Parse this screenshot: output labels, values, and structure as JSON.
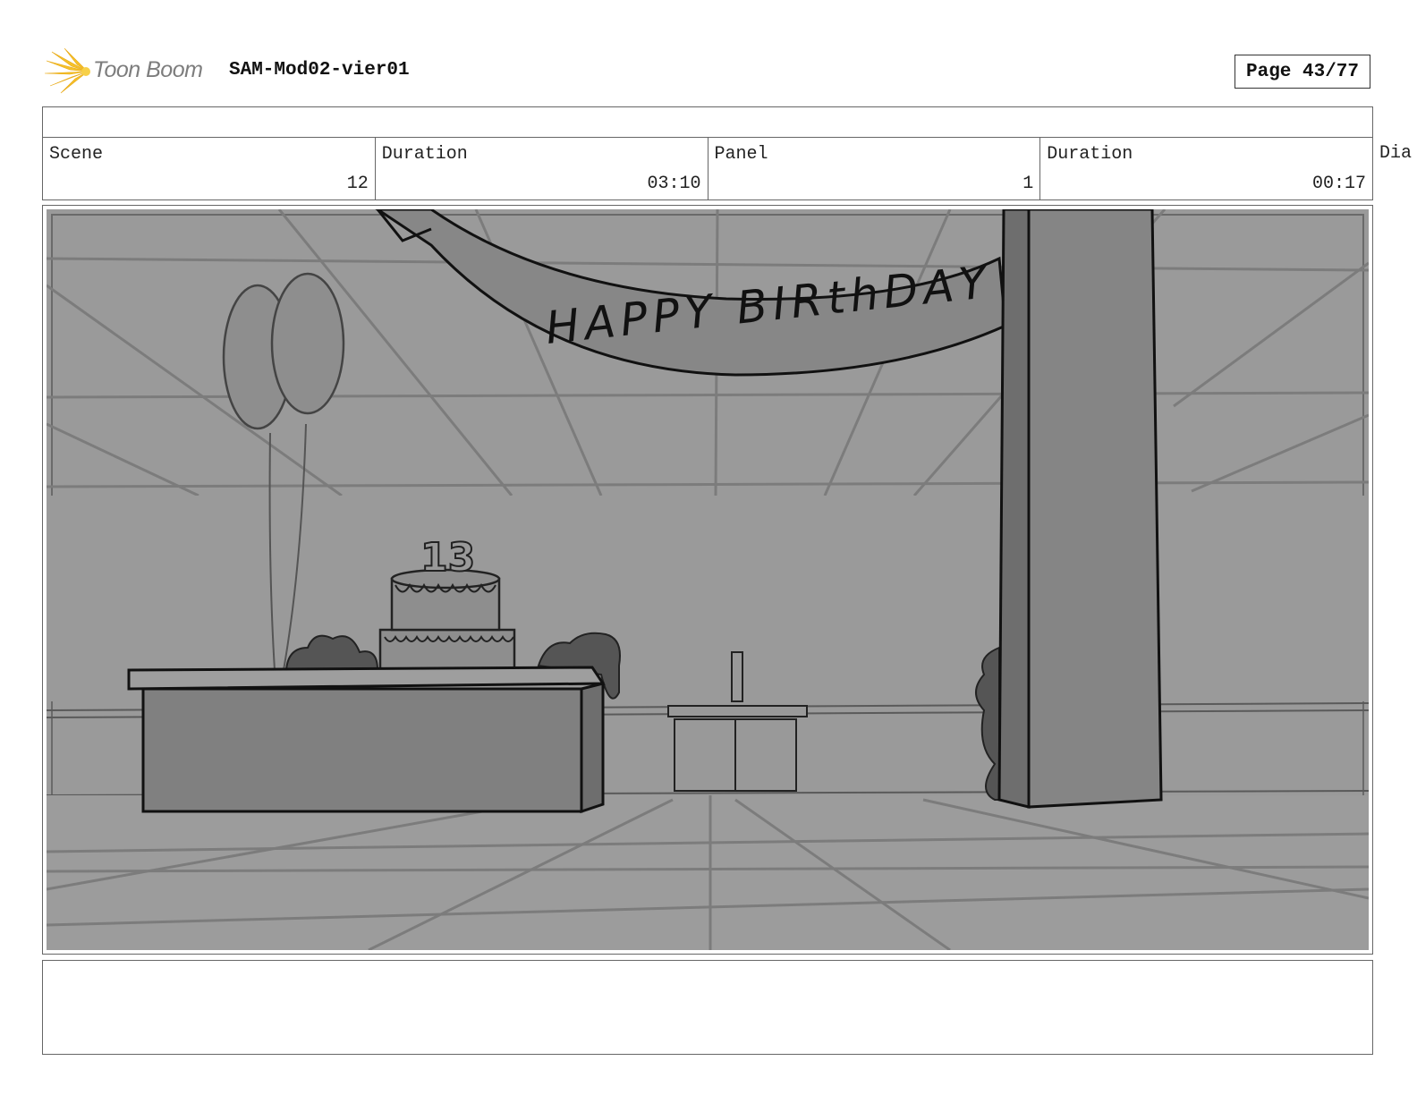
{
  "header": {
    "brand": "Toon Boom",
    "project_title": "SAM-Mod02-vier01",
    "page_label": "Page 43/77"
  },
  "info": {
    "scene_label": "Scene",
    "scene_value": "12",
    "scene_duration_label": "Duration",
    "scene_duration_value": "03:10",
    "panel_label": "Panel",
    "panel_value": "1",
    "panel_duration_label": "Duration",
    "panel_duration_value": "00:17",
    "dialog_label_cut": "Dia"
  },
  "sketch": {
    "banner_text": "HAPPY BIRthDAY",
    "cake_number": "13"
  },
  "caption": ""
}
